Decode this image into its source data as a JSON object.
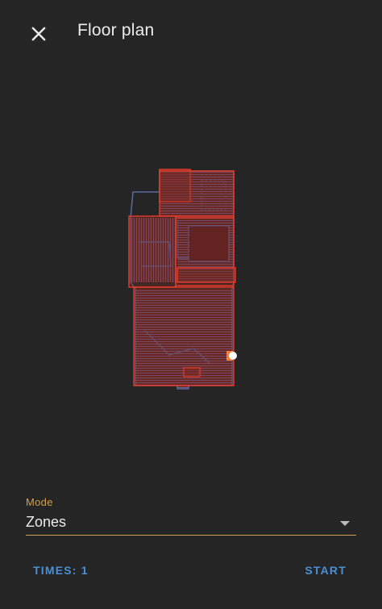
{
  "header": {
    "title": "Floor plan",
    "close_icon": "close-icon"
  },
  "map": {
    "wall_color": "#5a6aa0",
    "zone_color": "#e53a2a",
    "zone_fill": "#7a2a24",
    "robot_color": "#ff7a2a",
    "dock_color": "#ffffff"
  },
  "mode": {
    "label": "Mode",
    "value": "Zones",
    "label_color": "#d4a04a"
  },
  "actions": {
    "times_label": "TIMES: 1",
    "start_label": "START",
    "accent_color": "#4a8fd6"
  }
}
